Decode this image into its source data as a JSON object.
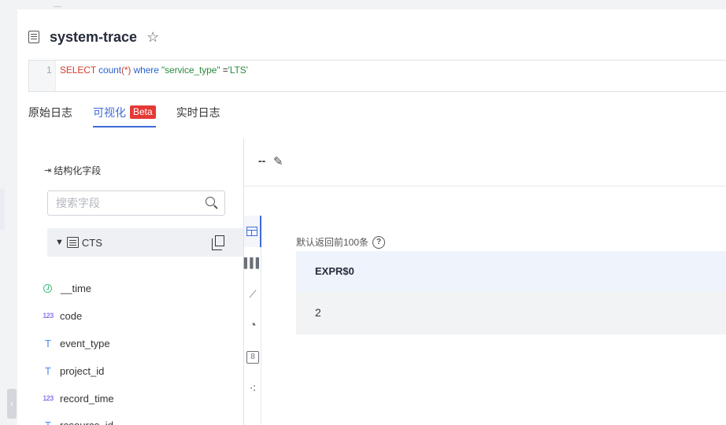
{
  "query": {
    "title": "system-trace",
    "line_number": "1",
    "sql": {
      "kw1": "SELECT",
      "fn": "count",
      "args": "(*)",
      "kw2": "where",
      "field": "\"service_type\"",
      "op": " =",
      "value": "'LTS'"
    }
  },
  "tabs": [
    {
      "label": "原始日志"
    },
    {
      "label": "可视化",
      "badge": "Beta"
    },
    {
      "label": "实时日志"
    }
  ],
  "field_panel": {
    "header": "结构化字段",
    "search_placeholder": "搜索字段",
    "group_label": "CTS",
    "fields": [
      {
        "type_icon": "time-icon",
        "name": "__time"
      },
      {
        "type_icon": "number-icon",
        "type_glyph": "123",
        "name": "code"
      },
      {
        "type_icon": "text-icon",
        "type_glyph": "T",
        "name": "event_type"
      },
      {
        "type_icon": "text-icon",
        "type_glyph": "T",
        "name": "project_id"
      },
      {
        "type_icon": "number-icon",
        "type_glyph": "123",
        "name": "record_time"
      },
      {
        "type_icon": "text-icon",
        "type_glyph": "T",
        "name": "resource_id"
      }
    ]
  },
  "chart": {
    "title": "--",
    "hint": "默认返回前100条",
    "help_glyph": "?",
    "icon_bar": [
      {
        "name": "table-icon",
        "active": true
      },
      {
        "name": "bar-chart-icon",
        "glyph": "▌▌▌"
      },
      {
        "name": "line-chart-icon",
        "glyph": "⟋"
      },
      {
        "name": "pie-chart-icon",
        "glyph": "◔"
      },
      {
        "name": "number-card-icon",
        "glyph": "8"
      },
      {
        "name": "scatter-icon",
        "glyph": "⁖"
      }
    ],
    "table": {
      "columns": [
        "EXPR$0"
      ],
      "rows": [
        [
          "2"
        ]
      ]
    }
  },
  "colors": {
    "accent": "#3f6ad8",
    "badge": "#e53935"
  }
}
